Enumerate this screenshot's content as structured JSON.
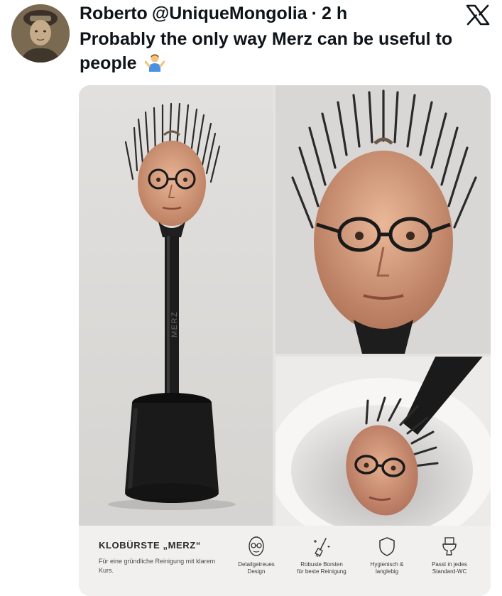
{
  "tweet": {
    "display_name": "Roberto",
    "handle": "@UniqueMongolia",
    "separator": "·",
    "time": "2 h",
    "text": "Probably the only way Merz can be useful to people",
    "emoji": "person-shrugging-emoji"
  },
  "header": {
    "platform_icon": "x-logo-icon"
  },
  "media": {
    "handle_engraving": "MERZ",
    "product": {
      "title": "KLOBÜRSTE „MERZ“",
      "description": "Für eine gründliche Reinigung mit klarem Kurs."
    },
    "features": [
      {
        "icon": "face-with-glasses-icon",
        "label_line1": "Detailgetreues",
        "label_line2": "Design"
      },
      {
        "icon": "sparkle-brush-icon",
        "label_line1": "Robuste Borsten",
        "label_line2": "für beste Reinigung"
      },
      {
        "icon": "shield-icon",
        "label_line1": "Hygienisch &",
        "label_line2": "langlebig"
      },
      {
        "icon": "toilet-icon",
        "label_line1": "Passt in jedes",
        "label_line2": "Standard-WC"
      }
    ]
  }
}
